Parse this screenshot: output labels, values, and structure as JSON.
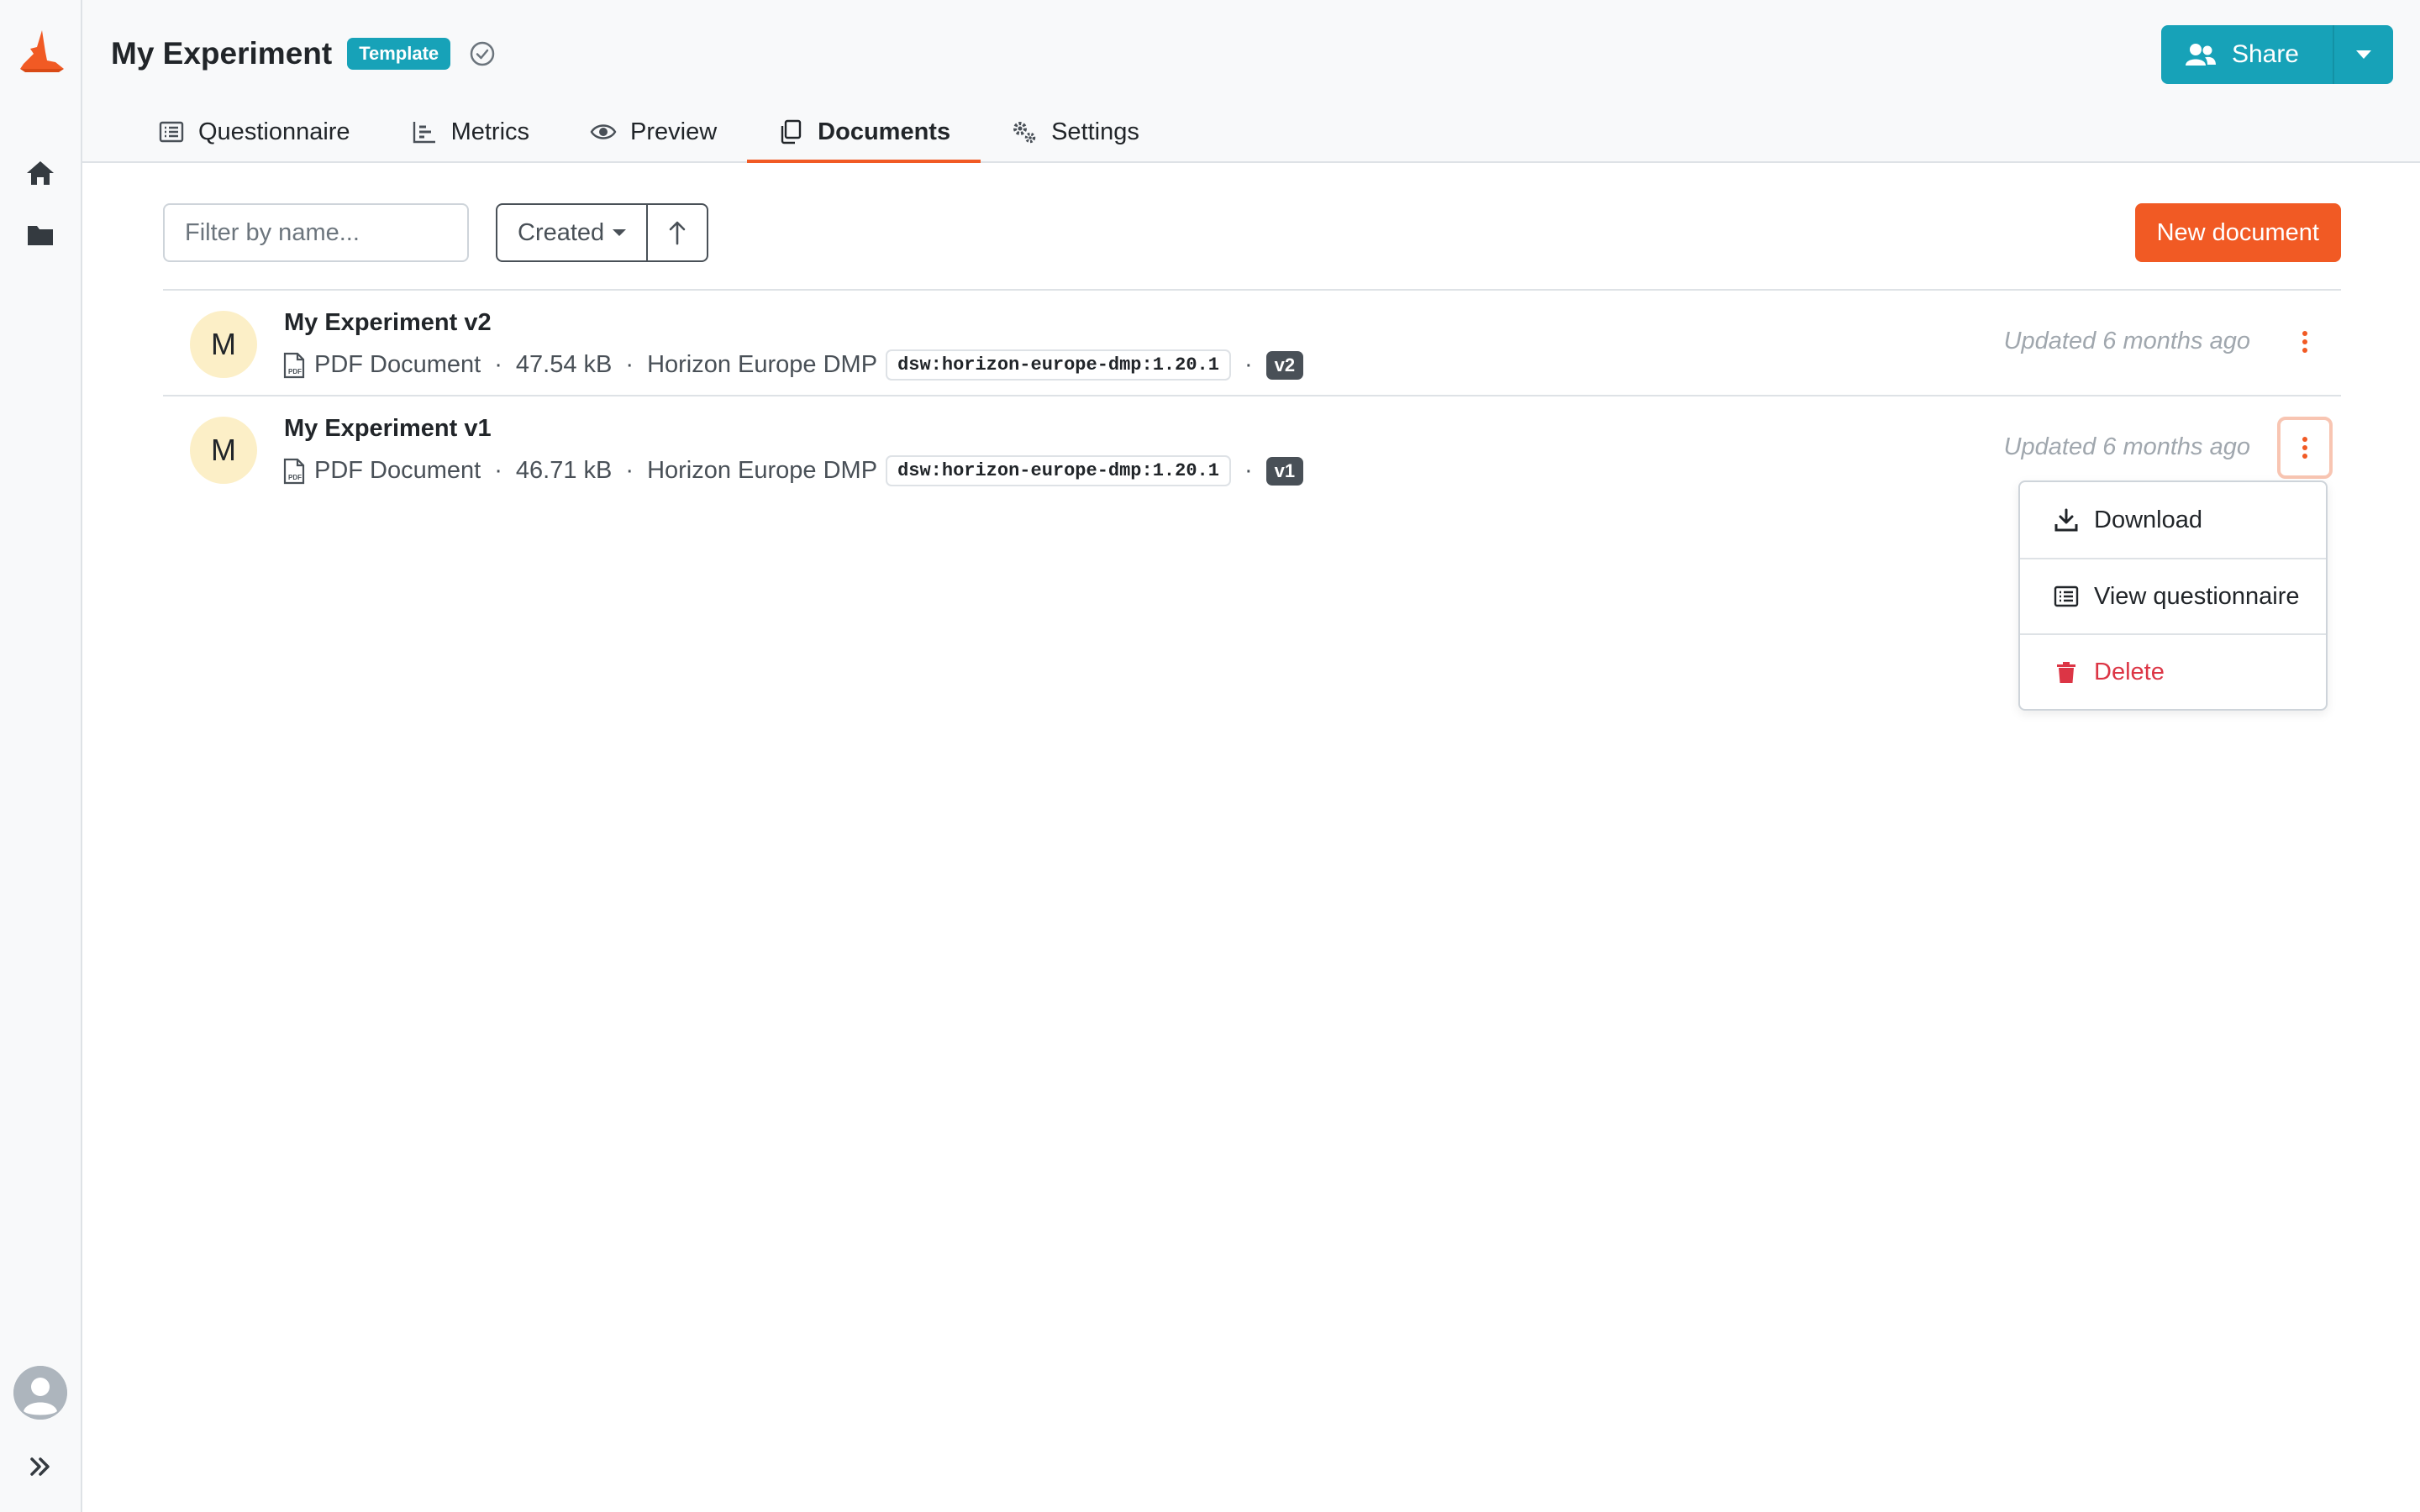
{
  "app": {
    "title": "My Experiment",
    "badge": "Template",
    "share_label": "Share",
    "accent_color": "#f15a24",
    "info_color": "#17a2b8"
  },
  "tabs": [
    {
      "label": "Questionnaire",
      "icon": "list-icon"
    },
    {
      "label": "Metrics",
      "icon": "bar-chart-icon"
    },
    {
      "label": "Preview",
      "icon": "eye-icon"
    },
    {
      "label": "Documents",
      "icon": "copy-icon",
      "active": true
    },
    {
      "label": "Settings",
      "icon": "gears-icon"
    }
  ],
  "toolbar": {
    "filter_placeholder": "Filter by name...",
    "sort_label": "Created",
    "new_document_label": "New document"
  },
  "documents": [
    {
      "avatar": "M",
      "name": "My Experiment v2",
      "format": "PDF Document",
      "size": "47.54 kB",
      "template_name": "Horizon Europe DMP",
      "template_id": "dsw:horizon-europe-dmp:1.20.1",
      "version": "v2",
      "updated": "Updated 6 months ago"
    },
    {
      "avatar": "M",
      "name": "My Experiment v1",
      "format": "PDF Document",
      "size": "46.71 kB",
      "template_name": "Horizon Europe DMP",
      "template_id": "dsw:horizon-europe-dmp:1.20.1",
      "version": "v1",
      "updated": "Updated 6 months ago"
    }
  ],
  "dropdown": {
    "download": "Download",
    "view_questionnaire": "View questionnaire",
    "delete": "Delete"
  },
  "separator": "·"
}
